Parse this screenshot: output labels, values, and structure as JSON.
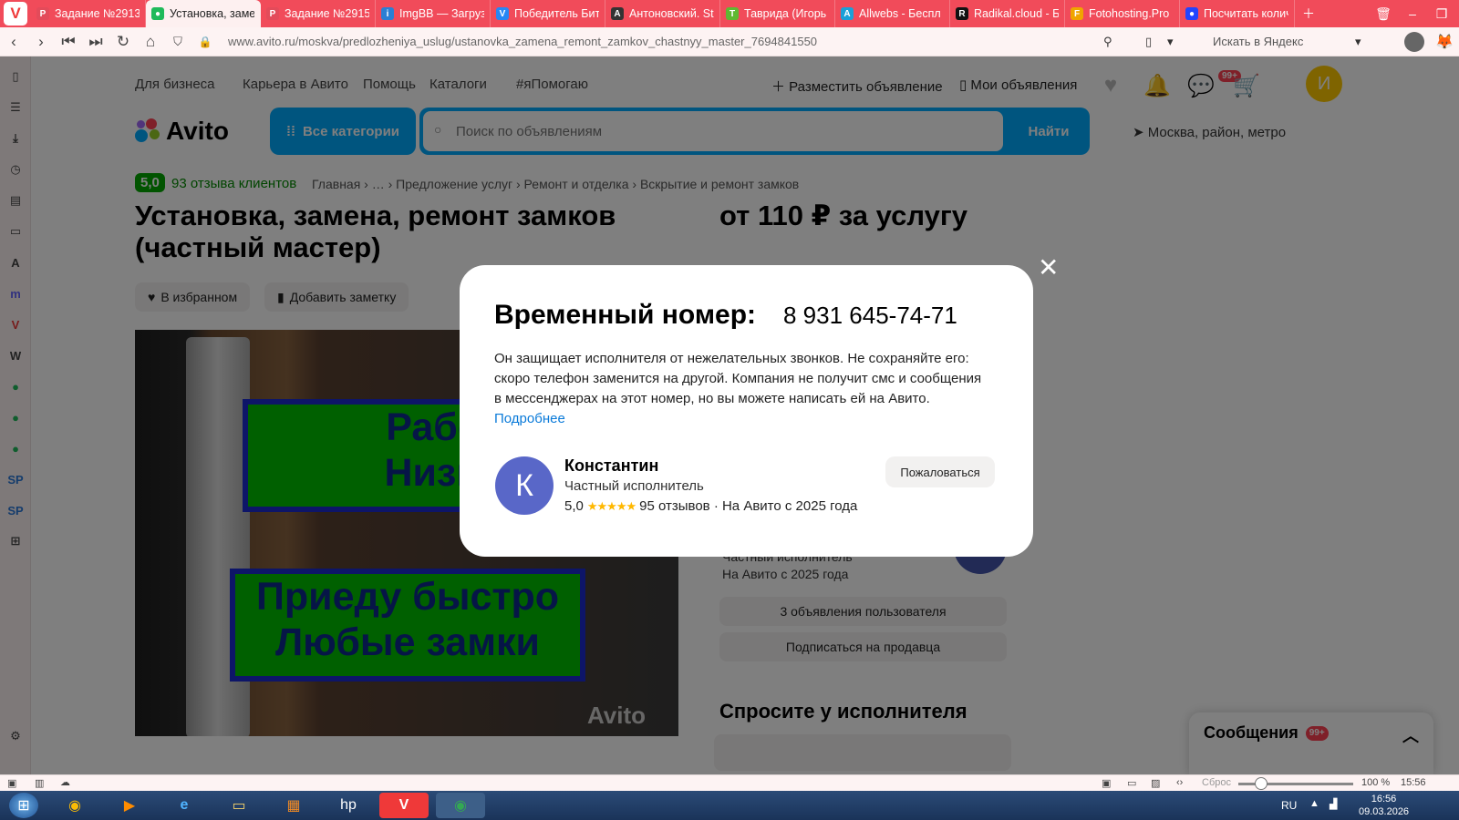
{
  "browser": {
    "tabs": [
      {
        "label": "Задание №2913",
        "fav": "P",
        "color": "#e34b5a"
      },
      {
        "label": "Установка, заме",
        "fav": "●",
        "color": "#1fba5a",
        "active": true
      },
      {
        "label": "Задание №2915",
        "fav": "P",
        "color": "#e34b5a"
      },
      {
        "label": "ImgBB — Загруз",
        "fav": "i",
        "color": "#2a7fd4"
      },
      {
        "label": "Победитель Бит",
        "fav": "V",
        "color": "#2787f5"
      },
      {
        "label": "Антоновский. St",
        "fav": "A",
        "color": "#333333"
      },
      {
        "label": "Таврида (Игорь",
        "fav": "T",
        "color": "#5fb832"
      },
      {
        "label": "Allwebs - Беспл",
        "fav": "A",
        "color": "#1aa0d8"
      },
      {
        "label": "Radikal.cloud - Б",
        "fav": "R",
        "color": "#111111"
      },
      {
        "label": "Fotohosting.Pro",
        "fav": "F",
        "color": "#f0a500"
      },
      {
        "label": "Посчитать колич",
        "fav": "●",
        "color": "#2244ff"
      }
    ],
    "url": "www.avito.ru/moskva/predlozheniya_uslug/ustanovka_zamena_remont_zamkov_chastnyy_master_7694841550",
    "yandex_search": "Искать в Яндекс",
    "status": {
      "reset": "Сброс",
      "zoom": "100 %",
      "time": "15:56"
    }
  },
  "header": {
    "nav": [
      "Для бизнеса",
      "Карьера в Авито",
      "Помощь",
      "Каталоги",
      "#яПомогаю"
    ],
    "post_ad": "Разместить объявление",
    "my_ads": "Мои объявления",
    "msg_badge": "99+",
    "avatar_letter": "И",
    "logo": "Avito",
    "all_categories": "Все категории",
    "search_placeholder": "Поиск по объявлениям",
    "find": "Найти",
    "location": "Москва, район, метро"
  },
  "listing": {
    "rating": "5,0",
    "reviews": "93 отзыва клиентов",
    "breadcrumbs": "Главная  ›  …  ›  Предложение услуг  ›  Ремонт и отделка  ›  Вскрытие и ремонт замков",
    "title": "Установка, замена, ремонт замков (частный мастер)",
    "price": "от 110 ₽ за услугу",
    "fav_button": "В избранном",
    "note_button": "Добавить заметку",
    "photo_line1": "Работаю",
    "photo_line2": "Низкие ц",
    "photo_line3": "Приеду быстро",
    "photo_line4": "Любые замки",
    "watermark": "Avito",
    "seller_role": "Частный исполнитель",
    "seller_since": "На Авито с 2025 года",
    "user_ads": "3 объявления пользователя",
    "subscribe": "Подписаться на продавца",
    "ask": "Спросите у исполнителя",
    "messages": "Сообщения",
    "messages_badge": "99+"
  },
  "modal": {
    "title": "Временный номер:",
    "phone": "8 931 645-74-71",
    "description": "Он защищает исполнителя от нежелательных звонков. Не сохраняйте его: скоро телефон заменится на другой. Компания не получит смс и сообщения в мессенджерах на этот номер, но вы можете написать ей на Авито.",
    "more": "Подробнее",
    "avatar_letter": "К",
    "name": "Константин",
    "role": "Частный исполнитель",
    "rating": "5,0",
    "stars": "★★★★★",
    "reviews": "95 отзывов · На Авито с 2025 года",
    "complain": "Пожаловаться"
  },
  "taskbar": {
    "lang": "RU",
    "time": "16:56",
    "date": "09.03.2026"
  }
}
